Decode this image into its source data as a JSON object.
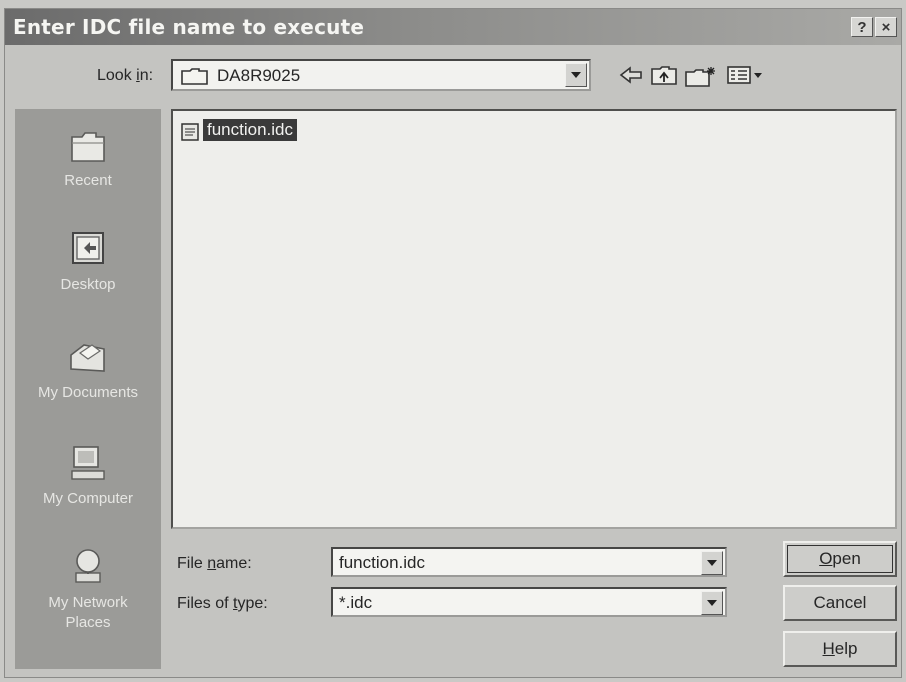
{
  "dialog": {
    "title": "Enter IDC file name to execute",
    "help_glyph": "?",
    "close_glyph": "×"
  },
  "look_in": {
    "label_pre": "Look ",
    "label_accel": "i",
    "label_post": "n:",
    "value": "DA8R9025"
  },
  "places": [
    {
      "label": "Recent",
      "icon": "recent-folder-icon"
    },
    {
      "label": "Desktop",
      "icon": "desktop-icon"
    },
    {
      "label": "My Documents",
      "icon": "my-documents-icon"
    },
    {
      "label": "My Computer",
      "icon": "my-computer-icon"
    },
    {
      "label": "My Network Places",
      "icon": "network-places-icon"
    }
  ],
  "files": [
    {
      "name": "function.idc",
      "selected": true
    }
  ],
  "file_name": {
    "label_pre": "File ",
    "label_accel": "n",
    "label_post": "ame:",
    "value": "function.idc"
  },
  "file_type": {
    "label_pre": "Files of ",
    "label_accel": "t",
    "label_post": "ype:",
    "value": "*.idc"
  },
  "buttons": {
    "open_accel": "O",
    "open_rest": "pen",
    "cancel": "Cancel",
    "help_accel": "H",
    "help_rest": "elp"
  }
}
